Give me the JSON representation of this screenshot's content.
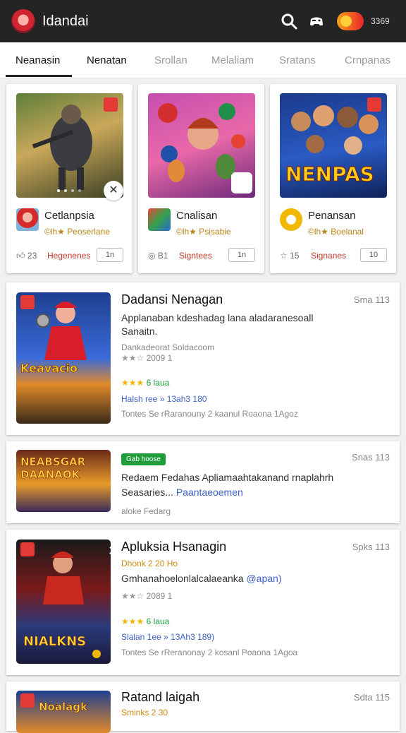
{
  "header": {
    "app_title": "Idandai",
    "balance": "3369",
    "icons": [
      "logo-icon",
      "search-icon",
      "gamepad-icon",
      "coin-icon"
    ]
  },
  "tabs": [
    {
      "label": "Neanasin",
      "active": true
    },
    {
      "label": "Nenatan",
      "active": false
    },
    {
      "label": "Srollan",
      "active": false
    },
    {
      "label": "Melaliam",
      "active": false
    },
    {
      "label": "Sratans",
      "active": false
    },
    {
      "label": "Crnpanas",
      "active": false
    }
  ],
  "featured": [
    {
      "name": "Cetlanpsia",
      "sub": "©lh★ Peoserlane",
      "likes": "23",
      "action": "Hegenenes",
      "button": "1n"
    },
    {
      "name": "Cnalisan",
      "sub": "©lh★ Psisabie",
      "likes": "B1",
      "action": "Signtees",
      "button": "1n"
    },
    {
      "name": "Penansan",
      "sub": "©lh★ Boelanal",
      "likes": "15",
      "action": "Signanes",
      "button": "10",
      "art_text": "NENPAS"
    }
  ],
  "cards": [
    {
      "title": "Dadansi Nenagan",
      "meta": "Sma 113",
      "desc1": "Applanaban kdeshadag lana aladaranesoall",
      "desc2": "Sanaitn.",
      "developer": "Dankadeorat Soldacoom",
      "rating_text": "2009  1",
      "rated": "6 laua",
      "price_line": "Halsh ree » 13ah3 180",
      "footer": "Tontes Se rRaranouny  2 kaanul Roaona 1Agoz",
      "art_text": "Keavacio"
    },
    {
      "badge": "Gab hoose",
      "meta": "Snas 113",
      "desc1": "Redaem Fedahas Apliamaahtakanand rnaplahrh",
      "desc2a": "Seasaries...",
      "desc2b": "Paantaeoemen",
      "footer": "aloke  Fedarg",
      "art_text": "NEABSGAR DAANAOK"
    },
    {
      "title": "Apluksia Hsanagin",
      "meta": "Spks 113",
      "developer": "Dhonk 2 20 Ho",
      "desc1a": "Gmhanahoelonlalcalaeanka",
      "desc1b": "@apan)",
      "rating_text": "2089  1",
      "rated": "6 laua",
      "price_line": "Slalan 1ee » 13Ah3 189)",
      "footer": "Tontes Se rReranonay  2 kosanl Poaona 1Agoa",
      "art_text": "NIALKNS"
    },
    {
      "title": "Ratand laigah",
      "meta": "Sdta 115",
      "developer": "Sminks 2 30",
      "art_text": "Noalagk"
    }
  ],
  "colors": {
    "topbar": "#242424",
    "accent_red": "#c0392b",
    "gold": "#c98a12",
    "blue": "#3b5fc4",
    "green_badge": "#1f9d3a",
    "star": "#f4b400"
  }
}
